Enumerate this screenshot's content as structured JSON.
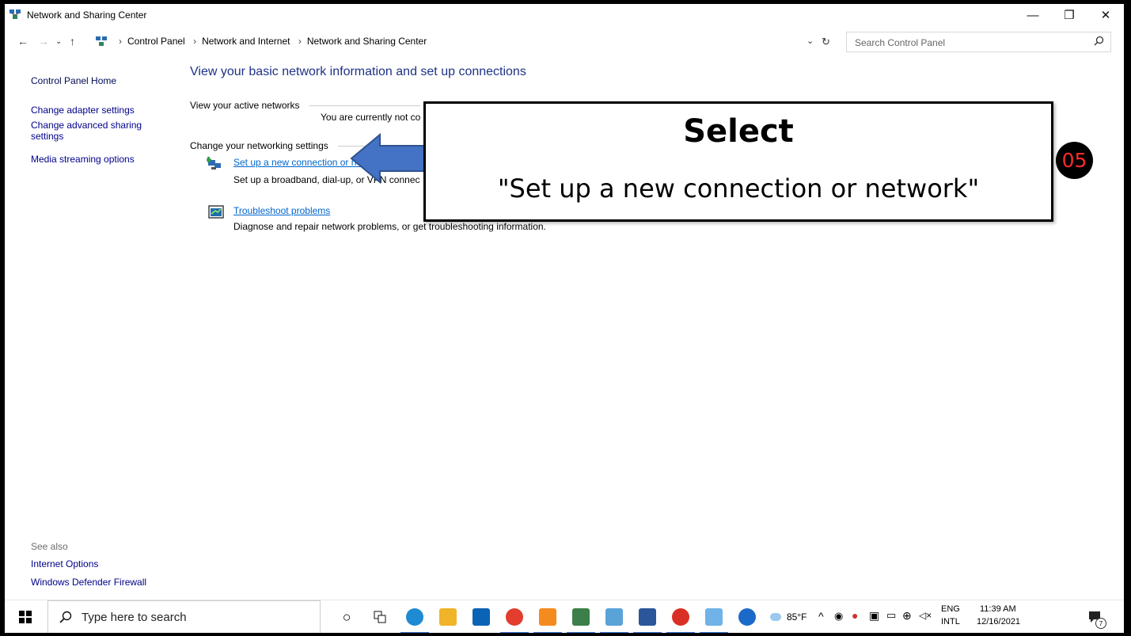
{
  "window": {
    "title": "Network and Sharing Center",
    "minimize_glyph": "—",
    "restore_glyph": "❐",
    "close_glyph": "✕"
  },
  "address_bar": {
    "breadcrumbs": [
      "Control Panel",
      "Network and Internet",
      "Network and Sharing Center"
    ],
    "search_placeholder": "Search Control Panel"
  },
  "left_pane": {
    "home": "Control Panel Home",
    "links": [
      "Change adapter settings",
      "Change advanced sharing",
      "settings",
      "Media streaming options"
    ],
    "see_also_label": "See also",
    "see_also": [
      "Internet Options",
      "Windows Defender Firewall"
    ]
  },
  "content": {
    "heading": "View your basic network information and set up connections",
    "active_networks_label": "View your active networks",
    "active_status": "You are currently not co",
    "change_settings_label": "Change your networking settings",
    "tasks": [
      {
        "link": "Set up a new connection or ne",
        "desc": "Set up a broadband, dial-up, or VPN connec",
        "icon": "network-setup-icon"
      },
      {
        "link": "Troubleshoot problems",
        "desc": "Diagnose and repair network problems, or get troubleshooting information.",
        "icon": "troubleshoot-icon"
      }
    ]
  },
  "callout": {
    "title": "Select",
    "instruction": "\"Set up a new connection or network\"",
    "step": "05"
  },
  "taskbar": {
    "search_placeholder": "Type here to search",
    "weather": "85°F",
    "lang_top": "ENG",
    "lang_bottom": "INTL",
    "time": "11:39 AM",
    "date": "12/16/2021",
    "notification_count": "7",
    "colors": {
      "accent": "#3a7bd5"
    }
  }
}
